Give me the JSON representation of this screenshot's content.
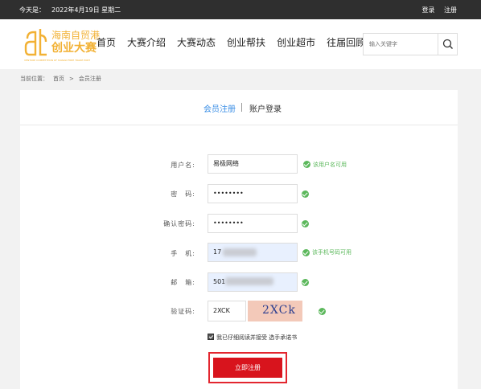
{
  "topbar": {
    "today_label": "今天是：",
    "date": "2022年4月19日 星期二",
    "login": "登录",
    "register": "注册"
  },
  "logo": {
    "line1": "海南自贸港",
    "line2": "创业大赛",
    "tagline": "VENTURE COMPETITION OF HAINAN FREE TRADE PORT",
    "color": "#f2b134"
  },
  "nav": [
    "首页",
    "大赛介绍",
    "大赛动态",
    "创业帮扶",
    "创业超市",
    "往届回顾"
  ],
  "search": {
    "placeholder": "输入关键字",
    "icon": "search-icon"
  },
  "breadcrumb": {
    "label": "当前位置：",
    "home": "首页",
    "sep": ">",
    "current": "会员注册"
  },
  "tabs": {
    "register": "会员注册",
    "login": "账户登录",
    "active_color": "#3a8ee6"
  },
  "form": {
    "username": {
      "label": "用户名:",
      "value": "易极网络",
      "hint": "该用户名可用"
    },
    "password": {
      "label": "密　码:",
      "value": "••••••••"
    },
    "confirm": {
      "label": "确认密码:",
      "value": "••••••••"
    },
    "phone": {
      "label": "手　机:",
      "value": "17",
      "hint": "该手机号码可用"
    },
    "email": {
      "label": "邮　箱:",
      "value": "501"
    },
    "captcha": {
      "label": "验证码:",
      "value": "2XCK",
      "image_text": "2XCk"
    },
    "agree_text": "我已仔细阅读并接受 选手承诺书",
    "submit": "立即注册",
    "submit_color": "#d8141d"
  }
}
